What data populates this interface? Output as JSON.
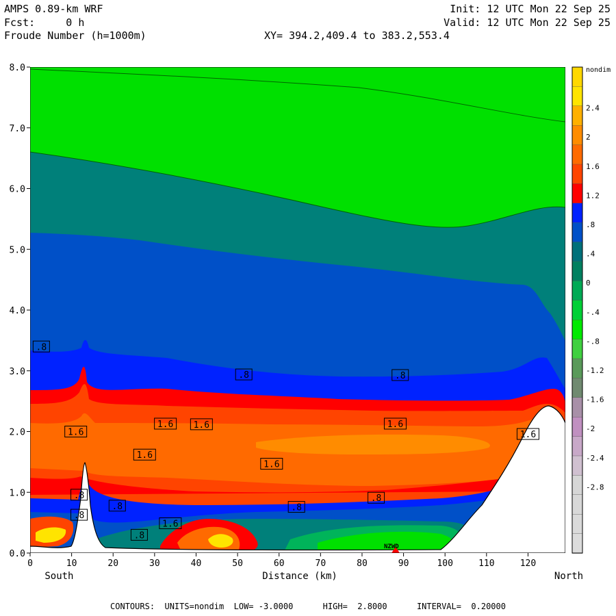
{
  "header": {
    "model": "AMPS 0.89-km WRF",
    "fcst": "Fcst:     0 h",
    "variable": "Froude Number (h=1000m)",
    "init": "Init: 12 UTC Mon 22 Sep 25",
    "valid": "Valid: 12 UTC Mon 22 Sep 25",
    "xy": "XY= 394.2,409.4 to 383.2,553.4"
  },
  "footer": {
    "contours": "CONTOURS:  UNITS=nondim  LOW= -3.0000      HIGH=  2.8000      INTERVAL=  0.20000"
  },
  "chart_data": {
    "type": "heatmap",
    "title": "Froude Number (h=1000m)",
    "xlabel": "Distance (km)",
    "ylabel": "",
    "x_end_labels": [
      "South",
      "North"
    ],
    "xlim": [
      0,
      129
    ],
    "ylim": [
      0,
      8
    ],
    "x_ticks": [
      "0",
      "10",
      "20",
      "30",
      "40",
      "50",
      "60",
      "70",
      "80",
      "90",
      "100",
      "110",
      "120"
    ],
    "y_ticks": [
      "0.0",
      "1.0",
      "2.0",
      "3.0",
      "4.0",
      "5.0",
      "6.0",
      "7.0",
      "8.0"
    ],
    "units": "nondim",
    "contour_low": -3.0,
    "contour_high": 2.8,
    "contour_interval": 0.2,
    "colorbar": {
      "labels": [
        "nondim",
        "2.4",
        "2",
        "1.6",
        "1.2",
        ".8",
        ".4",
        "0",
        "-.4",
        "-.8",
        "-1.2",
        "-1.6",
        "-2",
        "-2.4",
        "-2.8"
      ],
      "colors": [
        "#ffd800",
        "#ffe400",
        "#ffb000",
        "#ff8c00",
        "#ff6a00",
        "#ff4400",
        "#ff0000",
        "#0022ff",
        "#0050c8",
        "#00707a",
        "#008060",
        "#00aa55",
        "#00d036",
        "#00ea00",
        "#40d040",
        "#5a9a5a",
        "#708a70",
        "#a890a8",
        "#c090c0",
        "#c8a8c8",
        "#d0c0d0",
        "#d6d6d6",
        "#d8d8d8",
        "#dadada",
        "#dcdcdc"
      ]
    },
    "contour_labels": [
      {
        "text": ".8",
        "x": 2.7,
        "y": 3.4
      },
      {
        "text": ".8",
        "x": 51.5,
        "y": 2.94
      },
      {
        "text": ".8",
        "x": 89.2,
        "y": 2.93
      },
      {
        "text": "1.6",
        "x": 11.0,
        "y": 2.0
      },
      {
        "text": "1.6",
        "x": 32.6,
        "y": 2.13
      },
      {
        "text": "1.6",
        "x": 41.3,
        "y": 2.12
      },
      {
        "text": "1.6",
        "x": 88.0,
        "y": 2.13
      },
      {
        "text": "1.6",
        "x": 27.6,
        "y": 1.62
      },
      {
        "text": "1.6",
        "x": 58.2,
        "y": 1.47
      },
      {
        "text": "1.6",
        "x": 120.0,
        "y": 1.96
      },
      {
        "text": "1.6",
        "x": 33.8,
        "y": 0.49
      },
      {
        "text": ".8",
        "x": 11.8,
        "y": 0.96
      },
      {
        "text": ".8",
        "x": 11.8,
        "y": 0.63
      },
      {
        "text": ".8",
        "x": 21.0,
        "y": 0.78
      },
      {
        "text": ".8",
        "x": 26.3,
        "y": 0.3
      },
      {
        "text": ".8",
        "x": 64.2,
        "y": 0.76
      },
      {
        "text": ".8",
        "x": 83.4,
        "y": 0.91
      }
    ],
    "station_label": "NZWD",
    "station_x": 87.5
  },
  "icons": {
    "station_marker": "red-triangle-icon"
  }
}
